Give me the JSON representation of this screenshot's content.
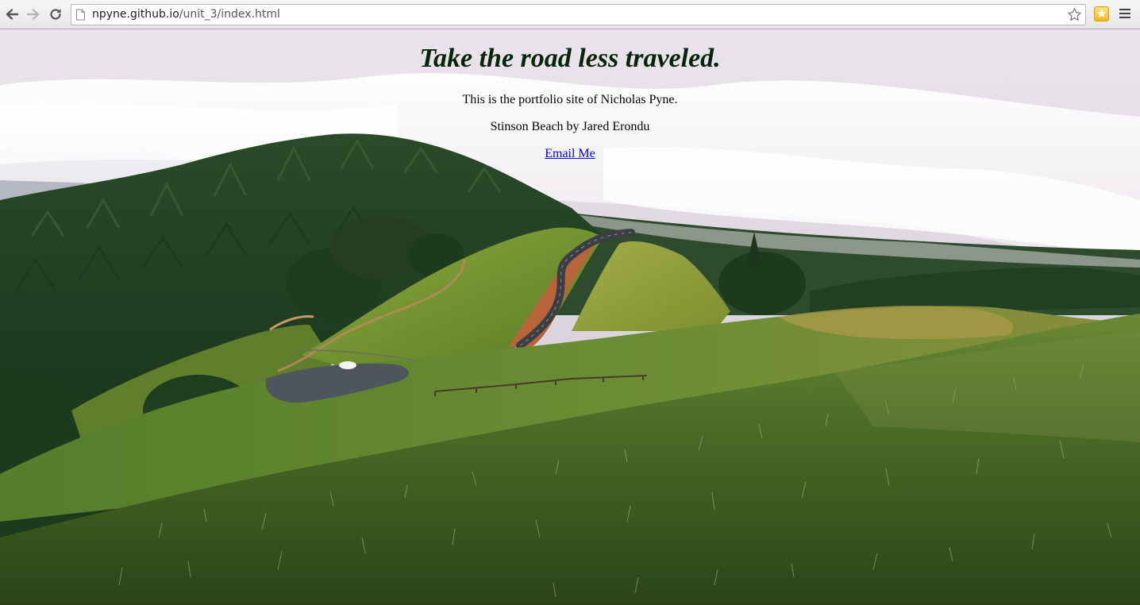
{
  "browser": {
    "url_host": "npyne.github.io",
    "url_path": "/unit_3/index.html",
    "icons": {
      "back": "back-arrow-icon",
      "forward": "forward-arrow-icon",
      "reload": "reload-icon",
      "page": "page-icon",
      "bookmark": "star-icon",
      "extension": "extension-icon",
      "menu": "menu-icon"
    }
  },
  "page": {
    "heading": "Take the road less traveled.",
    "tagline": "This is the portfolio site of Nicholas Pyne.",
    "photo_credit": "Stinson Beach by Jared Erondu",
    "email_link": "Email Me"
  },
  "colors": {
    "heading": "#06250a",
    "link": "#0000ee"
  }
}
